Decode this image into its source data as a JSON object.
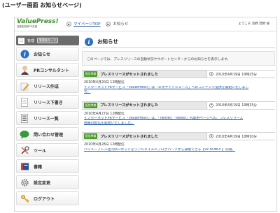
{
  "caption": "(ユーザー画面 お知らせページ)",
  "header": {
    "logo_text": "ValuePress!",
    "logo_subtitle": "自動配信型PR支援",
    "breadcrumb": [
      {
        "label": "マイページTOP",
        "link": true
      },
      {
        "label": "お知らせ",
        "link": false
      }
    ],
    "welcome": "ようこそ 消野 茂野 様"
  },
  "sidebar": {
    "admin_label": "管理",
    "admin_mode": "管理者モード",
    "items": [
      {
        "label": "お知らせ",
        "icon": "info-icon",
        "color": "#2d6fbf"
      },
      {
        "label": "PRコンサルタント",
        "icon": "consultant-icon",
        "color": "#c9a27a"
      },
      {
        "label": "リリース作成",
        "icon": "pencil-icon",
        "color": "#e0a020"
      },
      {
        "label": "リリース下書き",
        "icon": "document-icon",
        "color": "#999999"
      },
      {
        "label": "リリース一覧",
        "icon": "list-icon",
        "color": "#888888"
      },
      {
        "label": "問い合わせ管理",
        "icon": "chat-bubble-icon",
        "color": "#3a9a3a"
      },
      {
        "label": "ツール",
        "icon": "tools-icon",
        "color": "#555555"
      },
      {
        "label": "書籍",
        "icon": "book-icon",
        "color": "#c04040"
      },
      {
        "label": "設定変更",
        "icon": "gear-icon",
        "color": "#777777"
      },
      {
        "label": "ログアウト",
        "icon": "key-icon",
        "color": "#d0a020"
      }
    ]
  },
  "main": {
    "title": "お知らせ",
    "intro": "このページでは、プレスリリースの自動状況やサポートセンターからのお知らせを表示します。",
    "news": [
      {
        "badge": "配信準備",
        "title": "プレスリリースがセットされました",
        "date": "2010年4月19日 10時25分",
        "delivery": "2010年4月20日 12時配信",
        "link": "インターネットPRサービス「ValuePress!」は「エキサイトニュース」へのコンテンツ提供を開始いたしまし",
        "link_cont": "た。"
      },
      {
        "badge": "配信準備",
        "title": "プレスリリースがセットされました",
        "date": "2010年4月19日 10時15分",
        "delivery": "2010年4月27日 12時配信",
        "link": "インターネットPRサービス「ValuePress!」は、「Twitter」「Wassr」内専用ページへの、プレスリリース",
        "link_cont": "情報の配信を開始いたしました。"
      },
      {
        "badge": "配信準備",
        "title": "プレスリリースがセットされました",
        "date": "2010年4月19日 10時10分",
        "delivery": "2010年4月28日 12時配信",
        "link": "バリュープレス社内のロボットをリアルタイムにブログパーツから操縦できる【VP ROBOT】公開。",
        "link_cont": ""
      }
    ]
  }
}
